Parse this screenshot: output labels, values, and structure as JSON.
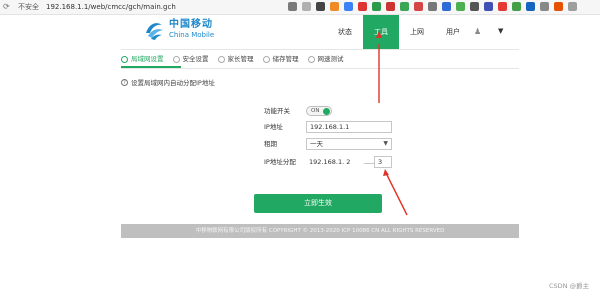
{
  "browser": {
    "insecure_label": "不安全",
    "url": "192.168.1.1/web/cmcc/gch/main.gch"
  },
  "brand": {
    "name_cn": "中国移动",
    "name_en": "China Mobile"
  },
  "topnav": {
    "items": [
      "状态",
      "工具",
      "上网",
      "用户"
    ],
    "active": "工具"
  },
  "subtabs": [
    "局域网设置",
    "安全设置",
    "家长管理",
    "储存管理",
    "网速测试"
  ],
  "hint": "设置局域网内自动分配IP地址",
  "form": {
    "switch_label": "功能开关",
    "switch_state": "ON",
    "ip_label": "IP地址",
    "ip_value": "192.168.1.1",
    "lease_label": "租期",
    "lease_value": "一天",
    "range_label": "IP地址分配",
    "range_prefix": "192.168.1. 2",
    "range_end": "3"
  },
  "save_label": "立即生效",
  "footer": "中移物联网有限公司版权所有 COPYRIGHT © 2013-2020 ICP 10086 CN ALL RIGHTS RESERVED",
  "watermark": "CSDN @爵主",
  "colors": {
    "accent": "#21a862",
    "brand_blue": "#1e88c9",
    "annotation": "#e0342b"
  }
}
